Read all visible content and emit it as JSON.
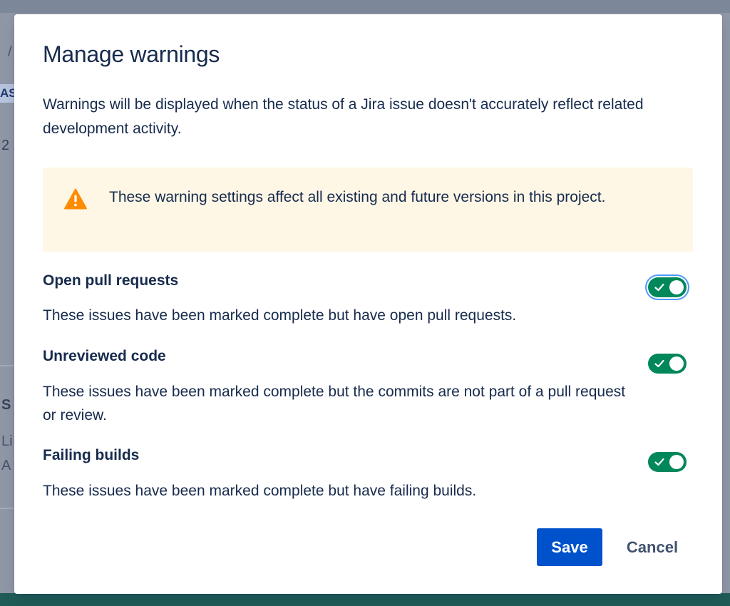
{
  "background": {
    "fragments": {
      "slash": "/",
      "tag": "AS",
      "num": "2",
      "s": "S",
      "li": "Li",
      "a": "A"
    }
  },
  "modal": {
    "title": "Manage warnings",
    "description": "Warnings will be displayed when the status of a Jira issue doesn't accurately reflect related development activity.",
    "banner": {
      "icon": "warning-triangle-icon",
      "icon_color": "#FF8B00",
      "background": "#FFF7E6",
      "text": "These warning settings affect all existing and future versions in this project."
    },
    "settings": [
      {
        "label": "Open pull requests",
        "description": "These issues have been marked complete but have open pull requests.",
        "enabled": true,
        "focused": true
      },
      {
        "label": "Unreviewed code",
        "description": "These issues have been marked complete but the commits are not part of a pull request or review.",
        "enabled": true,
        "focused": false
      },
      {
        "label": "Failing builds",
        "description": "These issues have been marked complete but have failing builds.",
        "enabled": true,
        "focused": false
      }
    ],
    "toggle_on_color": "#00875A",
    "focus_ring_color": "#4C9AFF",
    "buttons": {
      "save_label": "Save",
      "save_color": "#0052CC",
      "cancel_label": "Cancel"
    }
  }
}
